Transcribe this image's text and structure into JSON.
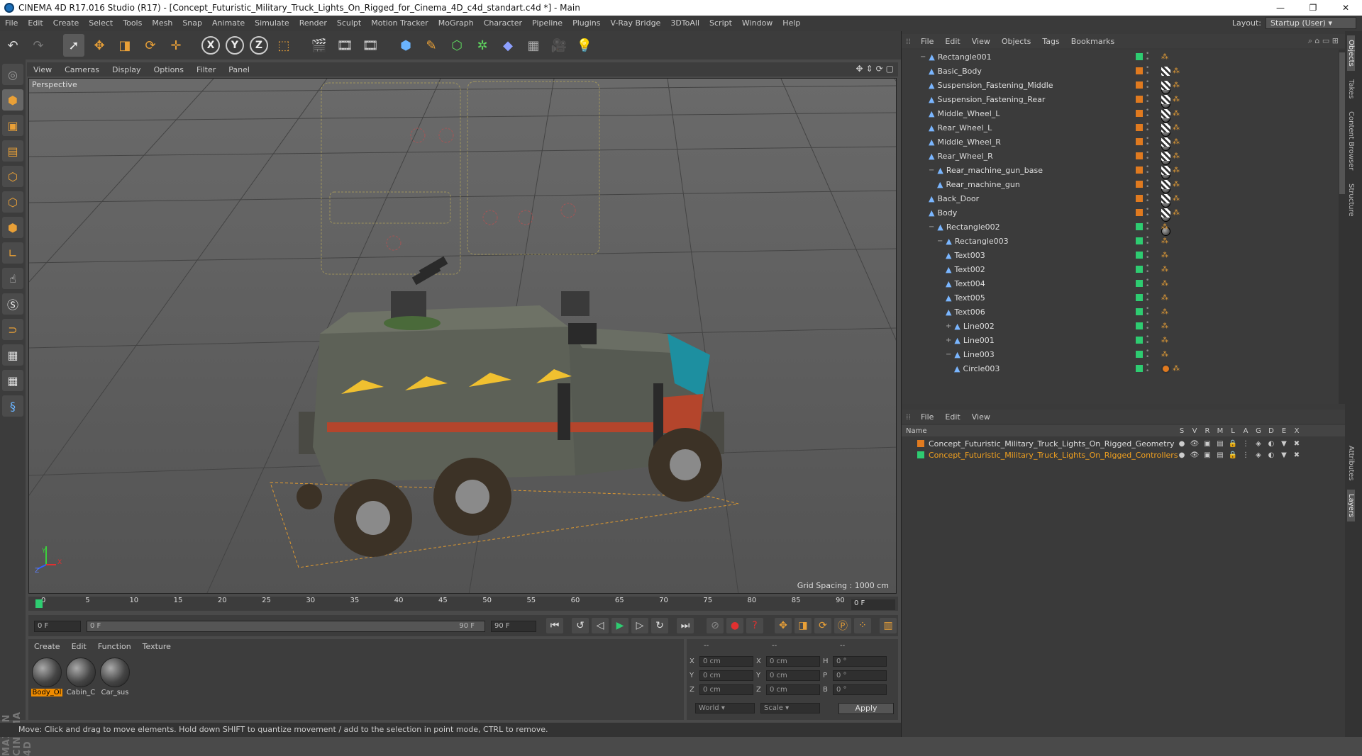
{
  "window": {
    "title": "CINEMA 4D R17.016 Studio (R17) - [Concept_Futuristic_Military_Truck_Lights_On_Rigged_for_Cinema_4D_c4d_standart.c4d *] - Main",
    "minimize": "—",
    "maximize": "❐",
    "close": "✕"
  },
  "menubar": {
    "items": [
      "File",
      "Edit",
      "Create",
      "Select",
      "Tools",
      "Mesh",
      "Snap",
      "Animate",
      "Simulate",
      "Render",
      "Sculpt",
      "Motion Tracker",
      "MoGraph",
      "Character",
      "Pipeline",
      "Plugins",
      "V-Ray Bridge",
      "3DToAll",
      "Script",
      "Window",
      "Help"
    ],
    "layout_label": "Layout:",
    "layout_value": "Startup (User)"
  },
  "viewport": {
    "menu": [
      "View",
      "Cameras",
      "Display",
      "Options",
      "Filter",
      "Panel"
    ],
    "label": "Perspective",
    "grid_spacing": "Grid Spacing : 1000 cm"
  },
  "timeline": {
    "ticks": [
      "0",
      "5",
      "10",
      "15",
      "20",
      "25",
      "30",
      "35",
      "40",
      "45",
      "50",
      "55",
      "60",
      "65",
      "70",
      "75",
      "80",
      "85",
      "90"
    ],
    "current_frame": "0 F",
    "start_field": "0 F",
    "range_start": "0 F",
    "range_end": "90 F",
    "end_field": "90 F"
  },
  "materials": {
    "menu": [
      "Create",
      "Edit",
      "Function",
      "Texture"
    ],
    "items": [
      {
        "name": "Body_Ol",
        "selected": true
      },
      {
        "name": "Cabin_C",
        "selected": false
      },
      {
        "name": "Car_sus",
        "selected": false
      }
    ]
  },
  "attributes": {
    "headers": [
      "--",
      "--",
      "--"
    ],
    "rows": [
      {
        "a": "X",
        "av": "0 cm",
        "b": "X",
        "bv": "0 cm",
        "c": "H",
        "cv": "0 °"
      },
      {
        "a": "Y",
        "av": "0 cm",
        "b": "Y",
        "bv": "0 cm",
        "c": "P",
        "cv": "0 °"
      },
      {
        "a": "Z",
        "av": "0 cm",
        "b": "Z",
        "bv": "0 cm",
        "c": "B",
        "cv": "0 °"
      }
    ],
    "coord_mode": "World",
    "transform_mode": "Scale",
    "apply_label": "Apply"
  },
  "status": "Move: Click and drag to move elements. Hold down SHIFT to quantize movement / add to the selection in point mode, CTRL to remove.",
  "object_manager": {
    "menu": [
      "File",
      "Edit",
      "View",
      "Objects",
      "Tags",
      "Bookmarks"
    ],
    "rows": [
      {
        "name": "Rectangle001",
        "indent": 0,
        "expander": "−",
        "color": "#2ecc71",
        "tags": [
          "nul"
        ]
      },
      {
        "name": "Basic_Body",
        "indent": 1,
        "expander": "",
        "color": "#e07a1f",
        "tags": [
          "mat",
          "chk",
          "nul"
        ]
      },
      {
        "name": "Suspension_Fastening_Middle",
        "indent": 1,
        "expander": "",
        "color": "#e07a1f",
        "tags": [
          "mat",
          "chk",
          "nul"
        ]
      },
      {
        "name": "Suspension_Fastening_Rear",
        "indent": 1,
        "expander": "",
        "color": "#e07a1f",
        "tags": [
          "mat",
          "chk",
          "nul"
        ]
      },
      {
        "name": "Middle_Wheel_L",
        "indent": 1,
        "expander": "",
        "color": "#e07a1f",
        "tags": [
          "mat",
          "chk",
          "nul"
        ]
      },
      {
        "name": "Rear_Wheel_L",
        "indent": 1,
        "expander": "",
        "color": "#e07a1f",
        "tags": [
          "mat",
          "chk",
          "nul"
        ]
      },
      {
        "name": "Middle_Wheel_R",
        "indent": 1,
        "expander": "",
        "color": "#e07a1f",
        "tags": [
          "mat",
          "chk",
          "nul"
        ]
      },
      {
        "name": "Rear_Wheel_R",
        "indent": 1,
        "expander": "",
        "color": "#e07a1f",
        "tags": [
          "mat",
          "chk",
          "nul"
        ]
      },
      {
        "name": "Rear_machine_gun_base",
        "indent": 1,
        "expander": "−",
        "color": "#e07a1f",
        "tags": [
          "mat",
          "chk",
          "nul"
        ]
      },
      {
        "name": "Rear_machine_gun",
        "indent": 2,
        "expander": "",
        "color": "#e07a1f",
        "tags": [
          "mat",
          "chk",
          "nul"
        ]
      },
      {
        "name": "Back_Door",
        "indent": 1,
        "expander": "",
        "color": "#e07a1f",
        "tags": [
          "mat",
          "chk",
          "nul"
        ]
      },
      {
        "name": "Body",
        "indent": 1,
        "expander": "",
        "color": "#e07a1f",
        "tags": [
          "mat",
          "chk",
          "nul"
        ]
      },
      {
        "name": "Rectangle002",
        "indent": 1,
        "expander": "−",
        "color": "#2ecc71",
        "tags": [
          "nul"
        ]
      },
      {
        "name": "Rectangle003",
        "indent": 2,
        "expander": "−",
        "color": "#2ecc71",
        "tags": [
          "nul"
        ]
      },
      {
        "name": "Text003",
        "indent": 3,
        "expander": "",
        "color": "#2ecc71",
        "tags": [
          "nul"
        ]
      },
      {
        "name": "Text002",
        "indent": 3,
        "expander": "",
        "color": "#2ecc71",
        "tags": [
          "nul"
        ]
      },
      {
        "name": "Text004",
        "indent": 3,
        "expander": "",
        "color": "#2ecc71",
        "tags": [
          "nul"
        ]
      },
      {
        "name": "Text005",
        "indent": 3,
        "expander": "",
        "color": "#2ecc71",
        "tags": [
          "nul"
        ]
      },
      {
        "name": "Text006",
        "indent": 3,
        "expander": "",
        "color": "#2ecc71",
        "tags": [
          "nul"
        ]
      },
      {
        "name": "Line002",
        "indent": 3,
        "expander": "+",
        "color": "#2ecc71",
        "tags": [
          "nul"
        ]
      },
      {
        "name": "Line001",
        "indent": 3,
        "expander": "+",
        "color": "#2ecc71",
        "tags": [
          "nul"
        ]
      },
      {
        "name": "Line003",
        "indent": 3,
        "expander": "−",
        "color": "#2ecc71",
        "tags": [
          "nul"
        ]
      },
      {
        "name": "Circle003",
        "indent": 4,
        "expander": "",
        "color": "#2ecc71",
        "tags": [
          "no",
          "nul"
        ]
      }
    ]
  },
  "side_tabs": [
    "Objects",
    "Takes",
    "Content Browser",
    "Structure"
  ],
  "side_tabs_lower": [
    "Attributes",
    "Layers"
  ],
  "layer_manager": {
    "menu": [
      "File",
      "Edit",
      "View"
    ],
    "name_header": "Name",
    "flags": [
      "S",
      "V",
      "R",
      "M",
      "L",
      "A",
      "G",
      "D",
      "E",
      "X"
    ],
    "layers": [
      {
        "name": "Concept_Futuristic_Military_Truck_Lights_On_Rigged_Geometry",
        "color": "#e07a1f",
        "text_color": "#dddddd"
      },
      {
        "name": "Concept_Futuristic_Military_Truck_Lights_On_Rigged_Controllers",
        "color": "#2ecc71",
        "text_color": "#f0a020"
      }
    ]
  },
  "axis_labels": {
    "y": "Y",
    "x": "X",
    "z": "Z"
  }
}
